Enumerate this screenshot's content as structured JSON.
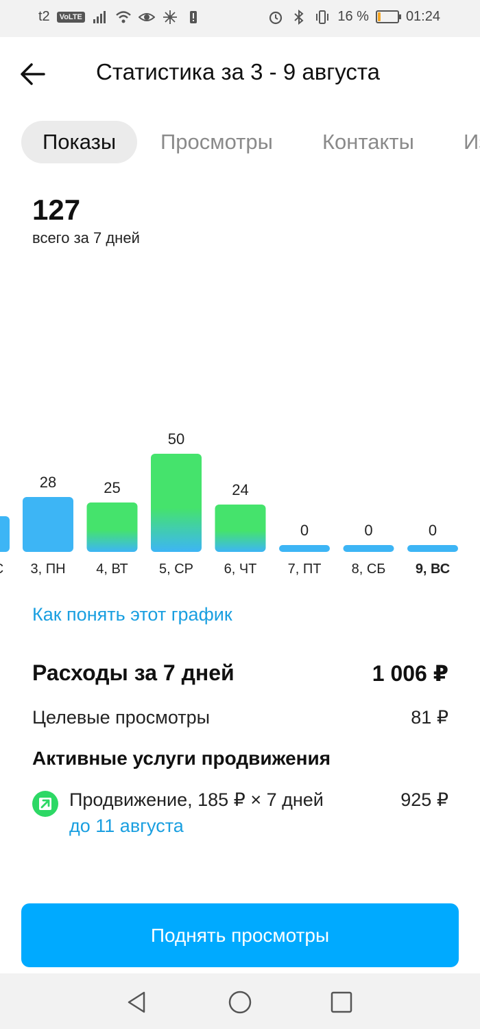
{
  "status_bar": {
    "carrier": "t2",
    "volte": "VoLTE",
    "battery_text": "16 %",
    "battery_level": 0.16,
    "time": "01:24"
  },
  "header": {
    "title": "Статистика за 3 - 9 августа"
  },
  "tabs": [
    {
      "label": "Показы"
    },
    {
      "label": "Просмотры"
    },
    {
      "label": "Контакты"
    },
    {
      "label": "Из"
    }
  ],
  "summary": {
    "total": "127",
    "caption": "всего за 7 дней"
  },
  "chart_data": {
    "type": "bar",
    "categories": [
      "3, ПН",
      "4, ВТ",
      "5, СР",
      "6, ЧТ",
      "7, ПТ",
      "8, СБ",
      "9, ВС"
    ],
    "values": [
      28,
      25,
      50,
      24,
      0,
      0,
      0
    ],
    "highlighted_category": "9, ВС",
    "colors": {
      "base": "#3db5f5",
      "promoted": "#45e36c"
    }
  },
  "help_link": "Как понять этот график",
  "expenses": {
    "title": "Расходы за 7 дней",
    "total": "1 006 ₽",
    "target_label": "Целевые просмотры",
    "target_value": "81 ₽",
    "active_title": "Активные услуги продвижения",
    "promo_text": "Продвижение, 185 ₽ × 7 дней",
    "promo_until": "до 11 августа",
    "promo_value": "925 ₽"
  },
  "cta": "Поднять просмотры",
  "colors": {
    "accent": "#00aaff",
    "link": "#1a9fe0",
    "green": "#2dd865"
  }
}
